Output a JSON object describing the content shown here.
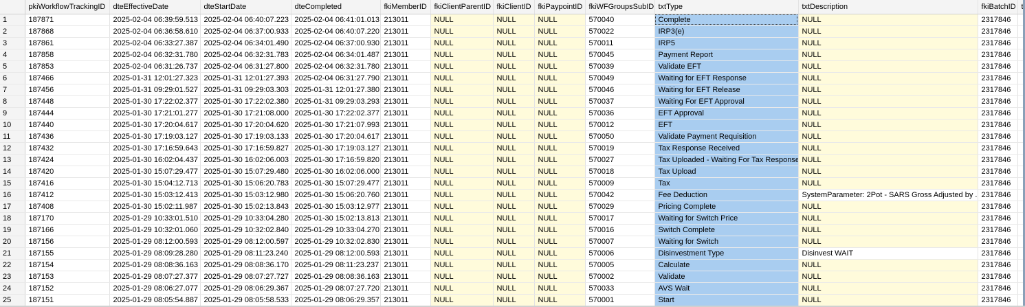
{
  "grid": {
    "columns": [
      "",
      "pkiWorkflowTrackingID",
      "dteEffectiveDate",
      "dteStartDate",
      "dteCompleted",
      "fkiMemberID",
      "fkiClientParentID",
      "fkiClientID",
      "fkiPaypointID",
      "fkiWFGroupsSubID",
      "txtType",
      "txtDescription",
      "fkiBatchID",
      "tx"
    ],
    "rows": [
      [
        "1",
        "187871",
        "2025-02-04 06:39:59.513",
        "2025-02-04 06:40:07.223",
        "2025-02-04 06:41:01.013",
        "213011",
        "NULL",
        "NULL",
        "NULL",
        "570040",
        "Complete",
        "NULL",
        "2317846",
        ""
      ],
      [
        "2",
        "187868",
        "2025-02-04 06:36:58.610",
        "2025-02-04 06:37:00.933",
        "2025-02-04 06:40:07.220",
        "213011",
        "NULL",
        "NULL",
        "NULL",
        "570022",
        "IRP3(e)",
        "NULL",
        "2317846",
        ""
      ],
      [
        "3",
        "187861",
        "2025-02-04 06:33:27.387",
        "2025-02-04 06:34:01.490",
        "2025-02-04 06:37:00.930",
        "213011",
        "NULL",
        "NULL",
        "NULL",
        "570011",
        "IRP5",
        "NULL",
        "2317846",
        ""
      ],
      [
        "4",
        "187858",
        "2025-02-04 06:32:31.780",
        "2025-02-04 06:32:31.783",
        "2025-02-04 06:34:01.487",
        "213011",
        "NULL",
        "NULL",
        "NULL",
        "570045",
        "Payment Report",
        "NULL",
        "2317846",
        ""
      ],
      [
        "5",
        "187853",
        "2025-02-04 06:31:26.737",
        "2025-02-04 06:31:27.800",
        "2025-02-04 06:32:31.780",
        "213011",
        "NULL",
        "NULL",
        "NULL",
        "570039",
        "Validate EFT",
        "NULL",
        "2317846",
        ""
      ],
      [
        "6",
        "187466",
        "2025-01-31 12:01:27.323",
        "2025-01-31 12:01:27.393",
        "2025-02-04 06:31:27.790",
        "213011",
        "NULL",
        "NULL",
        "NULL",
        "570049",
        "Waiting for EFT Response",
        "NULL",
        "2317846",
        ""
      ],
      [
        "7",
        "187456",
        "2025-01-31 09:29:01.527",
        "2025-01-31 09:29:03.303",
        "2025-01-31 12:01:27.380",
        "213011",
        "NULL",
        "NULL",
        "NULL",
        "570046",
        "Waiting for EFT Release",
        "NULL",
        "2317846",
        ""
      ],
      [
        "8",
        "187448",
        "2025-01-30 17:22:02.377",
        "2025-01-30 17:22:02.380",
        "2025-01-31 09:29:03.293",
        "213011",
        "NULL",
        "NULL",
        "NULL",
        "570037",
        "Waiting For EFT Approval",
        "NULL",
        "2317846",
        ""
      ],
      [
        "9",
        "187444",
        "2025-01-30 17:21:01.277",
        "2025-01-30 17:21:08.000",
        "2025-01-30 17:22:02.377",
        "213011",
        "NULL",
        "NULL",
        "NULL",
        "570036",
        "EFT Approval",
        "NULL",
        "2317846",
        ""
      ],
      [
        "10",
        "187440",
        "2025-01-30 17:20:04.617",
        "2025-01-30 17:20:04.620",
        "2025-01-30 17:21:07.993",
        "213011",
        "NULL",
        "NULL",
        "NULL",
        "570012",
        "EFT",
        "NULL",
        "2317846",
        ""
      ],
      [
        "11",
        "187436",
        "2025-01-30 17:19:03.127",
        "2025-01-30 17:19:03.133",
        "2025-01-30 17:20:04.617",
        "213011",
        "NULL",
        "NULL",
        "NULL",
        "570050",
        "Validate Payment Requisition",
        "NULL",
        "2317846",
        ""
      ],
      [
        "12",
        "187432",
        "2025-01-30 17:16:59.643",
        "2025-01-30 17:16:59.827",
        "2025-01-30 17:19:03.127",
        "213011",
        "NULL",
        "NULL",
        "NULL",
        "570019",
        "Tax Response Received",
        "NULL",
        "2317846",
        ""
      ],
      [
        "13",
        "187424",
        "2025-01-30 16:02:04.437",
        "2025-01-30 16:02:06.003",
        "2025-01-30 17:16:59.820",
        "213011",
        "NULL",
        "NULL",
        "NULL",
        "570027",
        "Tax Uploaded - Waiting For Tax Response",
        "NULL",
        "2317846",
        ""
      ],
      [
        "14",
        "187420",
        "2025-01-30 15:07:29.477",
        "2025-01-30 15:07:29.480",
        "2025-01-30 16:02:06.000",
        "213011",
        "NULL",
        "NULL",
        "NULL",
        "570018",
        "Tax Upload",
        "NULL",
        "2317846",
        ""
      ],
      [
        "15",
        "187416",
        "2025-01-30 15:04:12.713",
        "2025-01-30 15:06:20.783",
        "2025-01-30 15:07:29.477",
        "213011",
        "NULL",
        "NULL",
        "NULL",
        "570009",
        "Tax",
        "NULL",
        "2317846",
        ""
      ],
      [
        "16",
        "187412",
        "2025-01-30 15:03:12.413",
        "2025-01-30 15:03:12.980",
        "2025-01-30 15:06:20.760",
        "213011",
        "NULL",
        "NULL",
        "NULL",
        "570042",
        "Fee Deduction",
        "SystemParameter: 2Pot - SARS Gross Adjusted by ...",
        "2317846",
        ""
      ],
      [
        "17",
        "187408",
        "2025-01-30 15:02:11.987",
        "2025-01-30 15:02:13.843",
        "2025-01-30 15:03:12.977",
        "213011",
        "NULL",
        "NULL",
        "NULL",
        "570029",
        "Pricing Complete",
        "NULL",
        "2317846",
        ""
      ],
      [
        "18",
        "187170",
        "2025-01-29 10:33:01.510",
        "2025-01-29 10:33:04.280",
        "2025-01-30 15:02:13.813",
        "213011",
        "NULL",
        "NULL",
        "NULL",
        "570017",
        "Waiting for Switch Price",
        "NULL",
        "2317846",
        ""
      ],
      [
        "19",
        "187166",
        "2025-01-29 10:32:01.060",
        "2025-01-29 10:32:02.840",
        "2025-01-29 10:33:04.270",
        "213011",
        "NULL",
        "NULL",
        "NULL",
        "570016",
        "Switch Complete",
        "NULL",
        "2317846",
        ""
      ],
      [
        "20",
        "187156",
        "2025-01-29 08:12:00.593",
        "2025-01-29 08:12:00.597",
        "2025-01-29 10:32:02.830",
        "213011",
        "NULL",
        "NULL",
        "NULL",
        "570007",
        "Waiting for Switch",
        "NULL",
        "2317846",
        ""
      ],
      [
        "21",
        "187155",
        "2025-01-29 08:09:28.280",
        "2025-01-29 08:11:23.240",
        "2025-01-29 08:12:00.593",
        "213011",
        "NULL",
        "NULL",
        "NULL",
        "570006",
        "Disinvestment Type",
        "Disinvest WAIT",
        "2317846",
        ""
      ],
      [
        "22",
        "187154",
        "2025-01-29 08:08:36.163",
        "2025-01-29 08:08:36.170",
        "2025-01-29 08:11:23.237",
        "213011",
        "NULL",
        "NULL",
        "NULL",
        "570005",
        "Calculate",
        "NULL",
        "2317846",
        ""
      ],
      [
        "23",
        "187153",
        "2025-01-29 08:07:27.377",
        "2025-01-29 08:07:27.727",
        "2025-01-29 08:08:36.163",
        "213011",
        "NULL",
        "NULL",
        "NULL",
        "570002",
        "Validate",
        "NULL",
        "2317846",
        ""
      ],
      [
        "24",
        "187152",
        "2025-01-29 08:06:27.077",
        "2025-01-29 08:06:29.367",
        "2025-01-29 08:07:27.720",
        "213011",
        "NULL",
        "NULL",
        "NULL",
        "570033",
        "AVS Wait",
        "NULL",
        "2317846",
        ""
      ],
      [
        "25",
        "187151",
        "2025-01-29 08:05:54.887",
        "2025-01-29 08:05:58.533",
        "2025-01-29 08:06:29.357",
        "213011",
        "NULL",
        "NULL",
        "NULL",
        "570001",
        "Start",
        "NULL",
        "2317846",
        ""
      ]
    ]
  },
  "colors": {
    "null_cell": "#fffbdb",
    "selected_column": "#a9cdf0",
    "header_bg": "#f4f4f4"
  }
}
